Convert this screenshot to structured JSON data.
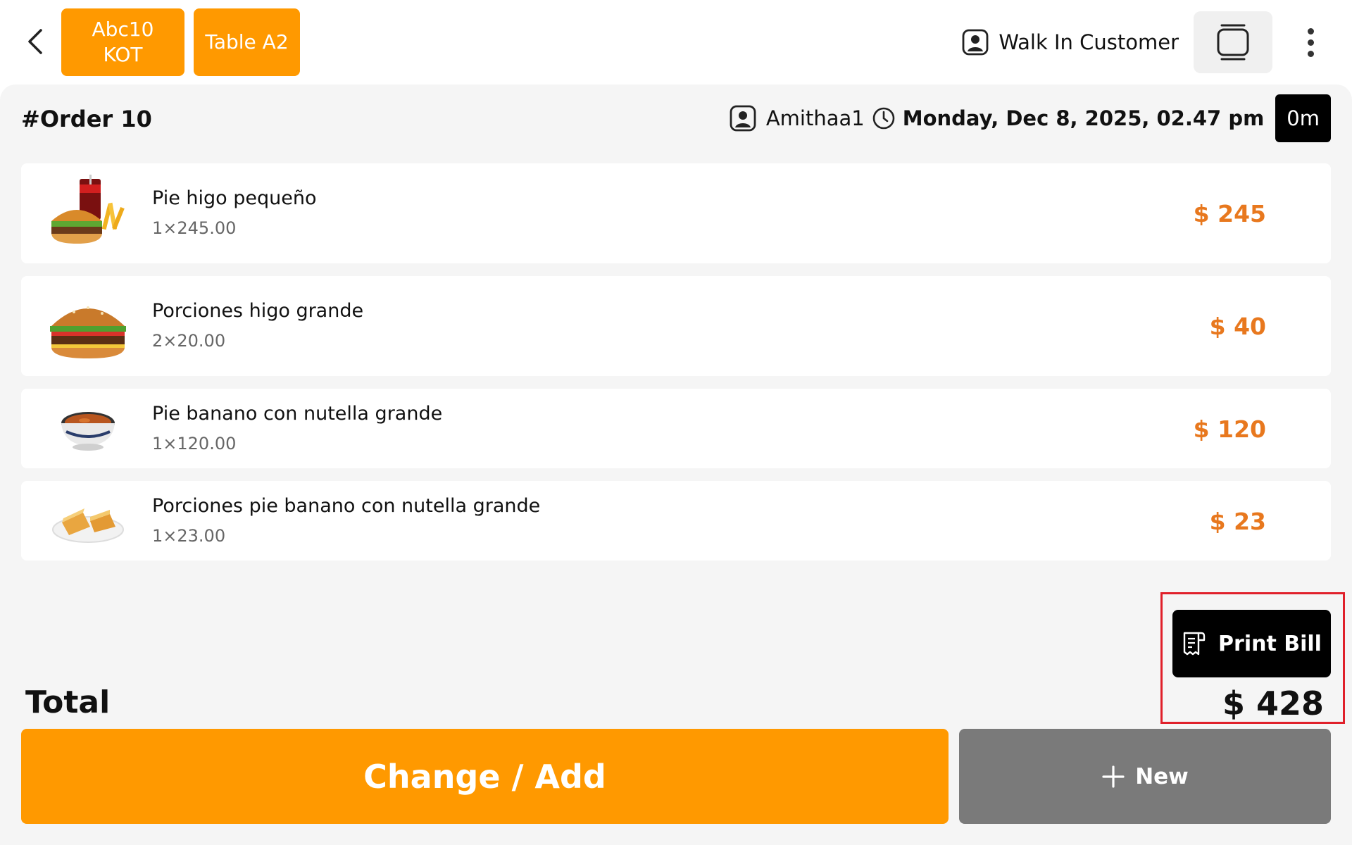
{
  "header": {
    "kot_chip_line1": "Abc10",
    "kot_chip_line2": "KOT",
    "table_chip": "Table A2",
    "customer": "Walk In Customer"
  },
  "order": {
    "title": "#Order 10",
    "user": "Amithaa1",
    "datetime": "Monday, Dec 8, 2025, 02.47 pm",
    "elapsed": "0m"
  },
  "items": [
    {
      "name": "Pie higo pequeño",
      "qty": "1×245.00",
      "price": "$ 245",
      "icon": "burger-combo-image"
    },
    {
      "name": "Porciones higo grande",
      "qty": "2×20.00",
      "price": "$ 40",
      "icon": "burger-image"
    },
    {
      "name": "Pie banano con nutella grande",
      "qty": "1×120.00",
      "price": "$ 120",
      "icon": "soup-bowl-image"
    },
    {
      "name": "Porciones pie banano con nutella grande",
      "qty": "1×23.00",
      "price": "$ 23",
      "icon": "cake-plate-image"
    }
  ],
  "actions": {
    "print_bill": "Print Bill",
    "change_add": "Change / Add",
    "new": "New"
  },
  "total": {
    "label": "Total",
    "value": "$ 428"
  },
  "colors": {
    "accent": "#ff9900",
    "price": "#e8781e",
    "highlight": "#e0202a",
    "new_button": "#7a7a7a"
  }
}
